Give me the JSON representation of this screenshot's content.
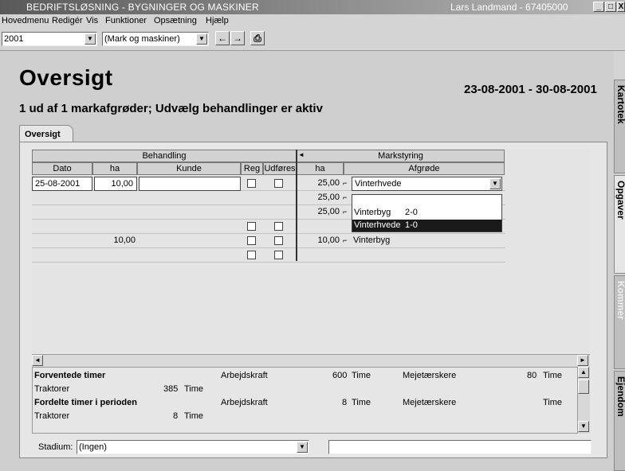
{
  "window": {
    "title": "BEDRIFTSLØSNING - BYGNINGER OG MASKINER",
    "user": "Lars Landmand - 67405000",
    "buttons": {
      "minimize": "_",
      "maximize": "□",
      "close": "X"
    }
  },
  "menu": [
    "Hovedmenu",
    "Redigér",
    "Vis",
    "Funktioner",
    "Opsætning",
    "Hjælp"
  ],
  "toolbar": {
    "year": "2001",
    "filter": "(Mark og maskiner)",
    "back_label": "←",
    "forward_label": "→",
    "print_label": "⎙"
  },
  "page": {
    "title": "Oversigt",
    "date_range": "23-08-2001 - 30-08-2001",
    "subtitle": "1 ud af 1 markafgrøder; Udvælg behandlinger er aktiv",
    "tab": "Oversigt"
  },
  "grid": {
    "group_behandling": "Behandling",
    "group_markstyring": "Markstyring",
    "headers": {
      "dato": "Dato",
      "ha": "ha",
      "kunde": "Kunde",
      "reg": "Reg",
      "udfores": "Udføres",
      "ha2": "ha",
      "afgrode": "Afgrøde"
    },
    "rows": [
      {
        "dato": "25-08-2001",
        "ha": "10,00",
        "kunde": "",
        "ha2": "25,00",
        "afgrode": "Vinterhvede"
      },
      {
        "dato": "",
        "ha": "",
        "kunde": "",
        "ha2": "25,00",
        "afgrode": ""
      },
      {
        "dato": "",
        "ha": "",
        "kunde": "",
        "ha2": "25,00",
        "afgrode": ""
      },
      {
        "dato": "",
        "ha": "",
        "kunde": "",
        "ha2": "",
        "afgrode": ""
      },
      {
        "dato": "",
        "ha": "10,00",
        "kunde": "",
        "ha2": "10,00",
        "afgrode": "Vinterbyg"
      },
      {
        "dato": "",
        "ha": "",
        "kunde": "",
        "ha2": "",
        "afgrode": ""
      }
    ],
    "dropdown": [
      {
        "name": "",
        "code": ""
      },
      {
        "name": "Vinterbyg",
        "code": "2-0"
      },
      {
        "name": "Vinterhvede",
        "code": "1-0"
      }
    ]
  },
  "summary": {
    "expected_label": "Forventede timer",
    "tractors": "Traktorer",
    "tractors_hours": "385",
    "time_unit": "Time",
    "labor": "Arbejdskraft",
    "labor_hours": "600",
    "harvesters": "Mejetærskere",
    "harvesters_hours": "80",
    "allocated_label": "Fordelte timer i perioden",
    "tractors_hours2": "8",
    "labor_hours2": "8"
  },
  "stadium": {
    "label": "Stadium:",
    "value": "(Ingen)",
    "text": ""
  },
  "side_tabs": [
    "Kartotek",
    "Opgaver",
    "Kommer",
    "Ejendom"
  ]
}
